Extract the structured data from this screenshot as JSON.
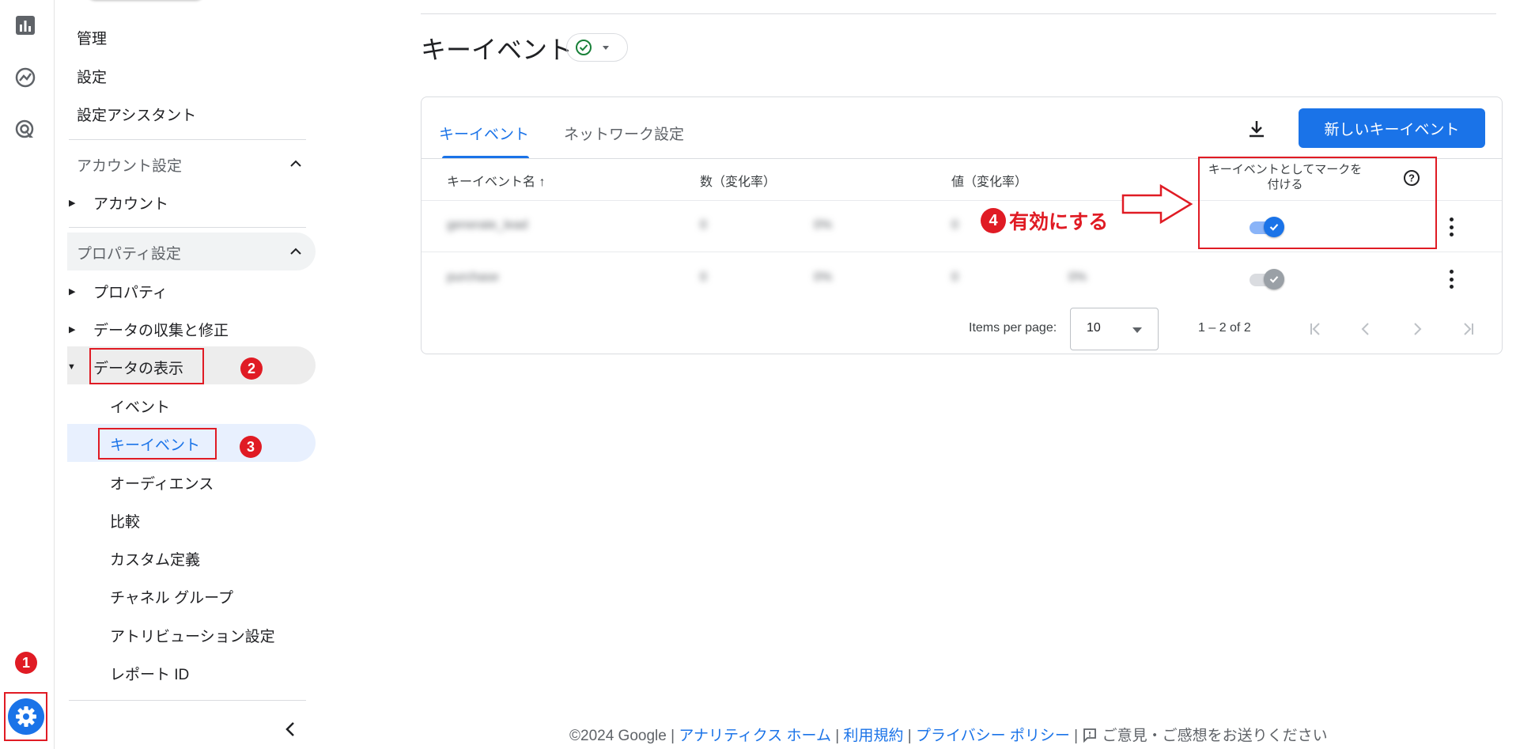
{
  "nav": {
    "items_top": [
      "管理",
      "設定",
      "設定アシスタント"
    ],
    "account_section": {
      "title": "アカウント設定",
      "items": [
        "アカウント"
      ]
    },
    "property_section": {
      "title": "プロパティ設定",
      "items": [
        "プロパティ",
        "データの収集と修正",
        "データの表示"
      ],
      "data_display_children": [
        "イベント",
        "キーイベント",
        "オーディエンス",
        "比較",
        "カスタム定義",
        "チャネル グループ",
        "アトリビューション設定",
        "レポート ID"
      ]
    }
  },
  "main": {
    "title": "キーイベント",
    "tabs": [
      {
        "label": "キーイベント",
        "active": true
      },
      {
        "label": "ネットワーク設定",
        "active": false
      }
    ],
    "new_button": "新しいキーイベント",
    "columns": [
      "キーイベント名 ↑",
      "数（変化率）",
      "値（変化率）",
      "キーイベントとしてマークを付ける"
    ],
    "rows": [
      {
        "name": "generate_lead",
        "count": "0",
        "count_change": "0%",
        "value": "0",
        "value_change": "0%",
        "marked": true
      },
      {
        "name": "purchase",
        "count": "0",
        "count_change": "0%",
        "value": "0",
        "value_change": "0%",
        "marked": true
      }
    ],
    "pagination": {
      "label": "Items per page:",
      "per_page": "10",
      "range": "1 – 2 of 2"
    }
  },
  "annotations": {
    "step1": "1",
    "step2": "2",
    "step3": "3",
    "step4_badge": "4",
    "step4_text": "有効にする"
  },
  "footer": {
    "copyright": "©2024 Google",
    "sep": "|",
    "links": [
      "アナリティクス ホーム",
      "利用規約",
      "プライバシー ポリシー"
    ],
    "feedback": "ご意見・ご感想をお送りください"
  },
  "colors": {
    "accent": "#1a73e8",
    "annotation": "#e01b24",
    "toggle_on_track": "#8ab4f8",
    "disabled_gray": "#9aa0a6"
  }
}
